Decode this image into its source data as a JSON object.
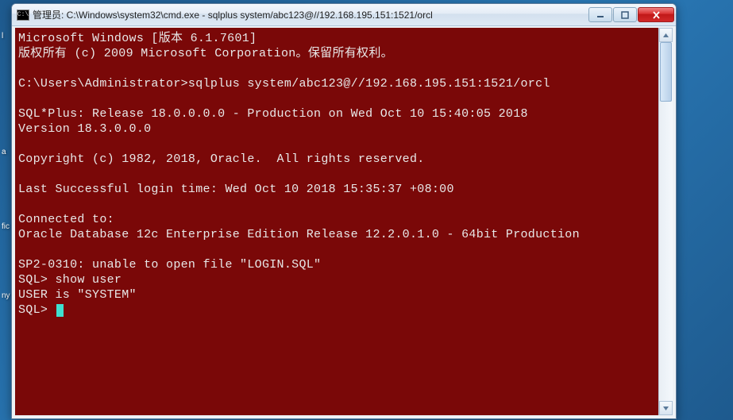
{
  "window": {
    "title_prefix": "管理员: ",
    "title_path": "C:\\Windows\\system32\\cmd.exe - sqlplus  system/abc123@//192.168.195.151:1521/orcl",
    "icon_label": "C:\\"
  },
  "controls": {
    "minimize": "Minimize",
    "maximize": "Maximize",
    "close": "Close"
  },
  "console": {
    "line01": "Microsoft Windows [版本 6.1.7601]",
    "line02": "版权所有 (c) 2009 Microsoft Corporation。保留所有权利。",
    "line03": "",
    "line04": "C:\\Users\\Administrator>sqlplus system/abc123@//192.168.195.151:1521/orcl",
    "line05": "",
    "line06": "SQL*Plus: Release 18.0.0.0.0 - Production on Wed Oct 10 15:40:05 2018",
    "line07": "Version 18.3.0.0.0",
    "line08": "",
    "line09": "Copyright (c) 1982, 2018, Oracle.  All rights reserved.",
    "line10": "",
    "line11": "Last Successful login time: Wed Oct 10 2018 15:35:37 +08:00",
    "line12": "",
    "line13": "Connected to:",
    "line14": "Oracle Database 12c Enterprise Edition Release 12.2.0.1.0 - 64bit Production",
    "line15": "",
    "line16": "SP2-0310: unable to open file \"LOGIN.SQL\"",
    "line17": "SQL> show user",
    "line18": "USER is \"SYSTEM\"",
    "line19": "SQL> "
  }
}
